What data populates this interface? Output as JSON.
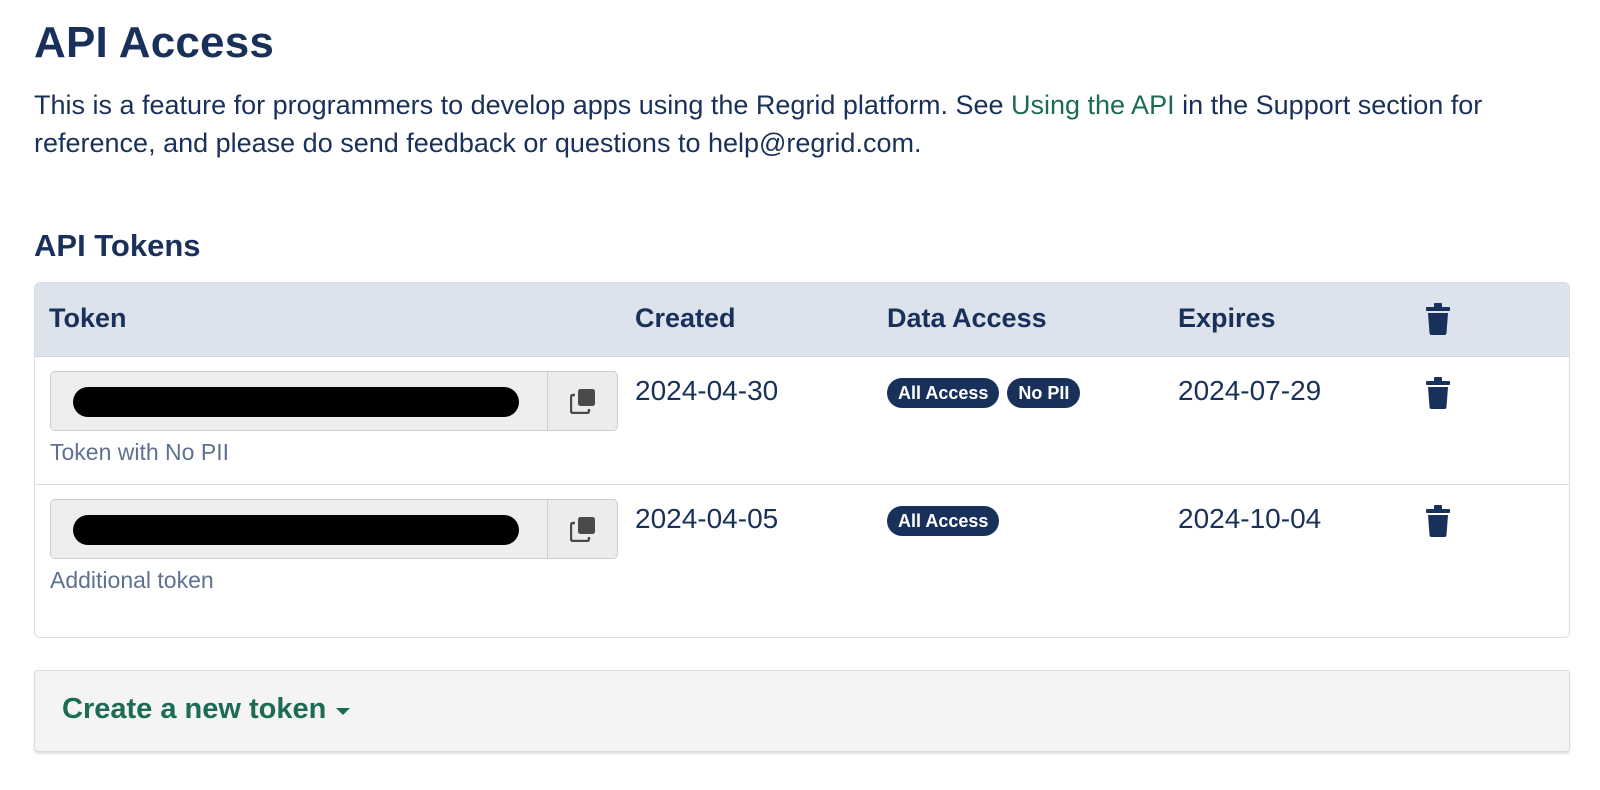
{
  "header": {
    "title": "API Access",
    "intro_before": "This is a feature for programmers to develop apps using the Regrid platform. See ",
    "intro_link": "Using the API",
    "intro_after": " in the Support section for reference, and please do send feedback or questions to help@regrid.com."
  },
  "tokens": {
    "section_title": "API Tokens",
    "columns": {
      "token": "Token",
      "created": "Created",
      "data_access": "Data Access",
      "expires": "Expires",
      "delete_icon": "trash-icon"
    },
    "rows": [
      {
        "name": "Token with No PII",
        "created": "2024-04-30",
        "badges": [
          "All Access",
          "No PII"
        ],
        "expires": "2024-07-29"
      },
      {
        "name": "Additional token",
        "created": "2024-04-05",
        "badges": [
          "All Access"
        ],
        "expires": "2024-10-04"
      }
    ]
  },
  "create": {
    "label": "Create a new token"
  },
  "colors": {
    "navy": "#19315a",
    "link_green": "#1b6b55",
    "header_bg": "#dde3ec",
    "badge_bg": "#19315a",
    "muted": "#5d7290"
  },
  "icons": {
    "copy": "copy-icon",
    "delete": "trash-icon",
    "dropdown": "caret-down-icon"
  }
}
